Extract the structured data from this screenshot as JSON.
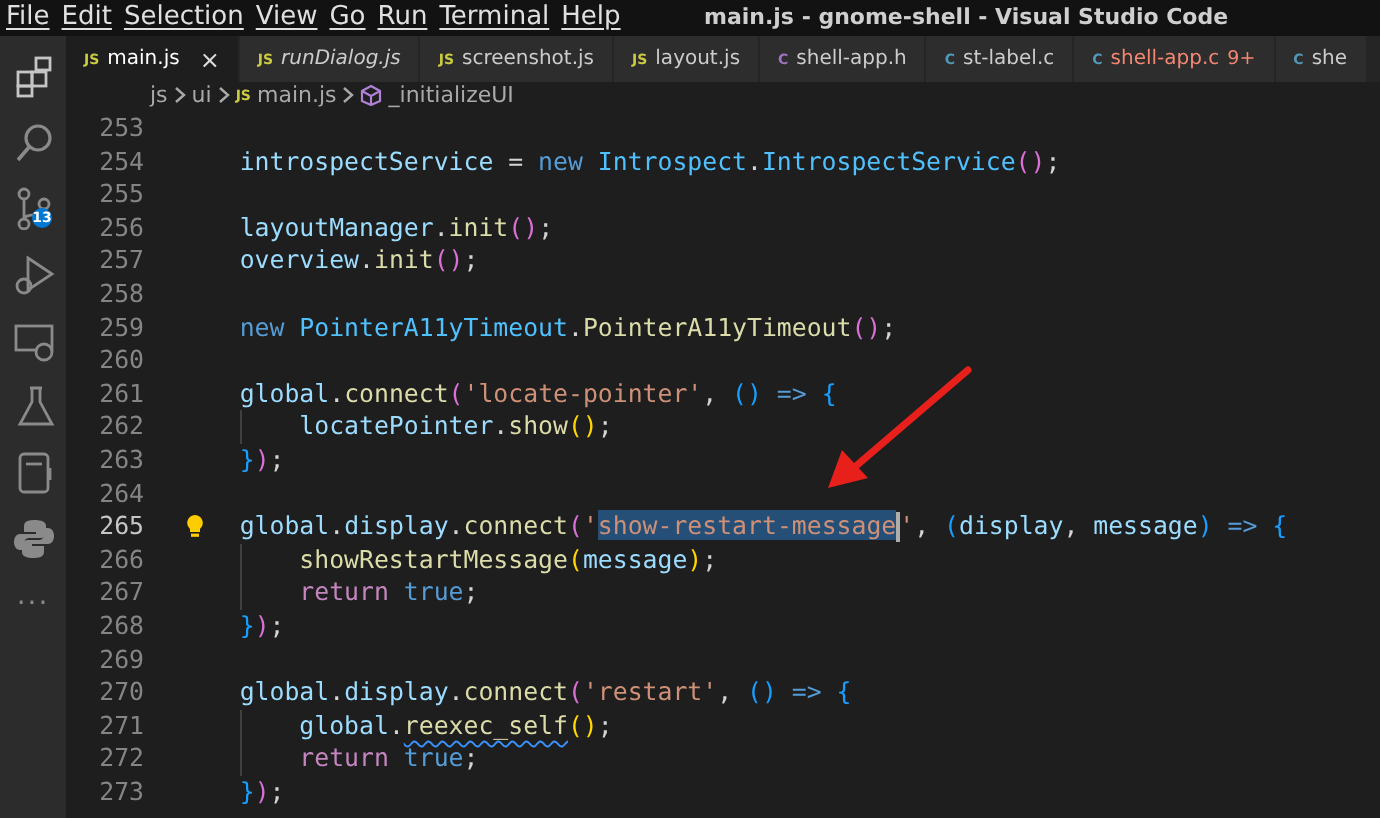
{
  "window": {
    "title": "main.js - gnome-shell - Visual Studio Code"
  },
  "menu": [
    "File",
    "Edit",
    "Selection",
    "View",
    "Go",
    "Run",
    "Terminal",
    "Help"
  ],
  "activity_bar": [
    {
      "kind": "explorer"
    },
    {
      "kind": "search"
    },
    {
      "kind": "source-control",
      "badge": "13"
    },
    {
      "kind": "run"
    },
    {
      "kind": "remote"
    },
    {
      "kind": "testing"
    },
    {
      "kind": "notebook"
    },
    {
      "kind": "python"
    },
    {
      "kind": "more",
      "text": "···"
    }
  ],
  "tabs": [
    {
      "icon": "JS",
      "kind": "js",
      "label": "main.js",
      "selected": true,
      "preview": false,
      "close": "×"
    },
    {
      "icon": "JS",
      "kind": "js",
      "label": "runDialog.js",
      "selected": false,
      "preview": true
    },
    {
      "icon": "JS",
      "kind": "js",
      "label": "screenshot.js",
      "selected": false,
      "preview": false
    },
    {
      "icon": "JS",
      "kind": "js",
      "label": "layout.js",
      "selected": false,
      "preview": false
    },
    {
      "icon": "C",
      "kind": "h",
      "label": "shell-app.h",
      "selected": false,
      "preview": false
    },
    {
      "icon": "C",
      "kind": "c",
      "label": "st-label.c",
      "selected": false,
      "preview": false
    },
    {
      "icon": "C",
      "kind": "c-error",
      "label": "shell-app.c",
      "selected": false,
      "preview": false,
      "problems": "9+"
    },
    {
      "icon": "C",
      "kind": "c",
      "label": "she",
      "selected": false,
      "preview": false
    }
  ],
  "breadcrumb": [
    {
      "kind": "folder",
      "label": "js"
    },
    {
      "kind": "folder",
      "label": "ui"
    },
    {
      "kind": "file",
      "icon": "JS",
      "label": "main.js"
    },
    {
      "kind": "method",
      "label": "_initializeUI"
    }
  ],
  "editor": {
    "lines": [
      {
        "number": "253",
        "current": false,
        "lightbulb": false
      },
      {
        "number": "254",
        "current": false,
        "lightbulb": false,
        "tokens": [
          {
            "text": "    introspectService",
            "kind": "var"
          },
          {
            "text": " = ",
            "kind": "plain"
          },
          {
            "text": "new",
            "kind": "kw"
          },
          {
            "text": " Introspect",
            "kind": "cls"
          },
          {
            "text": ".",
            "kind": "plain"
          },
          {
            "text": "IntrospectService",
            "kind": "cls"
          },
          {
            "text": "()",
            "kind": "b2"
          },
          {
            "text": ";",
            "kind": "plain"
          }
        ]
      },
      {
        "number": "255",
        "current": false,
        "lightbulb": false
      },
      {
        "number": "256",
        "current": false,
        "lightbulb": false,
        "tokens": [
          {
            "text": "    layoutManager",
            "kind": "var"
          },
          {
            "text": ".",
            "kind": "plain"
          },
          {
            "text": "init",
            "kind": "fn"
          },
          {
            "text": "()",
            "kind": "b2"
          },
          {
            "text": ";",
            "kind": "plain"
          }
        ]
      },
      {
        "number": "257",
        "current": false,
        "lightbulb": false,
        "tokens": [
          {
            "text": "    overview",
            "kind": "var"
          },
          {
            "text": ".",
            "kind": "plain"
          },
          {
            "text": "init",
            "kind": "fn"
          },
          {
            "text": "()",
            "kind": "b2"
          },
          {
            "text": ";",
            "kind": "plain"
          }
        ]
      },
      {
        "number": "258",
        "current": false,
        "lightbulb": false
      },
      {
        "number": "259",
        "current": false,
        "lightbulb": false,
        "tokens": [
          {
            "text": "    new",
            "kind": "kw"
          },
          {
            "text": " PointerA11yTimeout",
            "kind": "cls"
          },
          {
            "text": ".",
            "kind": "plain"
          },
          {
            "text": "PointerA11yTimeout",
            "kind": "fn"
          },
          {
            "text": "()",
            "kind": "b2"
          },
          {
            "text": ";",
            "kind": "plain"
          }
        ]
      },
      {
        "number": "260",
        "current": false,
        "lightbulb": false
      },
      {
        "number": "261",
        "current": false,
        "lightbulb": false,
        "tokens": [
          {
            "text": "    global",
            "kind": "var"
          },
          {
            "text": ".",
            "kind": "plain"
          },
          {
            "text": "connect",
            "kind": "fn"
          },
          {
            "text": "(",
            "kind": "b2"
          },
          {
            "text": "'locate-pointer'",
            "kind": "str"
          },
          {
            "text": ", ",
            "kind": "plain"
          },
          {
            "text": "()",
            "kind": "b3"
          },
          {
            "text": " => ",
            "kind": "kw"
          },
          {
            "text": "{",
            "kind": "b3"
          }
        ]
      },
      {
        "number": "262",
        "current": false,
        "lightbulb": false,
        "tokens": [
          {
            "text": "        locatePointer",
            "kind": "var"
          },
          {
            "text": ".",
            "kind": "plain"
          },
          {
            "text": "show",
            "kind": "fn"
          },
          {
            "text": "()",
            "kind": "b1"
          },
          {
            "text": ";",
            "kind": "plain"
          }
        ]
      },
      {
        "number": "263",
        "current": false,
        "lightbulb": false,
        "tokens": [
          {
            "text": "    }",
            "kind": "b3"
          },
          {
            "text": ")",
            "kind": "b2"
          },
          {
            "text": ";",
            "kind": "plain"
          }
        ]
      },
      {
        "number": "264",
        "current": false,
        "lightbulb": false
      },
      {
        "number": "265",
        "current": true,
        "lightbulb": true,
        "tokens": [
          {
            "text": "    global",
            "kind": "var"
          },
          {
            "text": ".",
            "kind": "plain"
          },
          {
            "text": "display",
            "kind": "var"
          },
          {
            "text": ".",
            "kind": "plain"
          },
          {
            "text": "connect",
            "kind": "fn"
          },
          {
            "text": "(",
            "kind": "b2"
          },
          {
            "text": "'",
            "kind": "str"
          },
          {
            "text": "show-restart-message",
            "kind": "sel"
          },
          {
            "text": "'",
            "kind": "str"
          },
          {
            "text": ", ",
            "kind": "plain"
          },
          {
            "text": "(",
            "kind": "b3"
          },
          {
            "text": "display",
            "kind": "var"
          },
          {
            "text": ", ",
            "kind": "plain"
          },
          {
            "text": "message",
            "kind": "var"
          },
          {
            "text": ")",
            "kind": "b3"
          },
          {
            "text": " => ",
            "kind": "kw"
          },
          {
            "text": "{",
            "kind": "b3"
          }
        ]
      },
      {
        "number": "266",
        "current": false,
        "lightbulb": false,
        "tokens": [
          {
            "text": "        showRestartMessage",
            "kind": "fn"
          },
          {
            "text": "(",
            "kind": "b1"
          },
          {
            "text": "message",
            "kind": "var"
          },
          {
            "text": ")",
            "kind": "b1"
          },
          {
            "text": ";",
            "kind": "plain"
          }
        ]
      },
      {
        "number": "267",
        "current": false,
        "lightbulb": false,
        "tokens": [
          {
            "text": "        return",
            "kind": "ctrl"
          },
          {
            "text": " true",
            "kind": "kw"
          },
          {
            "text": ";",
            "kind": "plain"
          }
        ]
      },
      {
        "number": "268",
        "current": false,
        "lightbulb": false,
        "tokens": [
          {
            "text": "    }",
            "kind": "b3"
          },
          {
            "text": ")",
            "kind": "b2"
          },
          {
            "text": ";",
            "kind": "plain"
          }
        ]
      },
      {
        "number": "269",
        "current": false,
        "lightbulb": false
      },
      {
        "number": "270",
        "current": false,
        "lightbulb": false,
        "tokens": [
          {
            "text": "    global",
            "kind": "var"
          },
          {
            "text": ".",
            "kind": "plain"
          },
          {
            "text": "display",
            "kind": "var"
          },
          {
            "text": ".",
            "kind": "plain"
          },
          {
            "text": "connect",
            "kind": "fn"
          },
          {
            "text": "(",
            "kind": "b2"
          },
          {
            "text": "'restart'",
            "kind": "str"
          },
          {
            "text": ", ",
            "kind": "plain"
          },
          {
            "text": "()",
            "kind": "b3"
          },
          {
            "text": " => ",
            "kind": "kw"
          },
          {
            "text": "{",
            "kind": "b3"
          }
        ]
      },
      {
        "number": "271",
        "current": false,
        "lightbulb": false,
        "tokens": [
          {
            "text": "        global",
            "kind": "var"
          },
          {
            "text": ".",
            "kind": "plain"
          },
          {
            "text": "reexec_self",
            "kind": "warn"
          },
          {
            "text": "()",
            "kind": "b1"
          },
          {
            "text": ";",
            "kind": "plain"
          }
        ]
      },
      {
        "number": "272",
        "current": false,
        "lightbulb": false,
        "tokens": [
          {
            "text": "        return",
            "kind": "ctrl"
          },
          {
            "text": " true",
            "kind": "kw"
          },
          {
            "text": ";",
            "kind": "plain"
          }
        ]
      },
      {
        "number": "273",
        "current": false,
        "lightbulb": false,
        "tokens": [
          {
            "text": "    }",
            "kind": "b3"
          },
          {
            "text": ")",
            "kind": "b2"
          },
          {
            "text": ";",
            "kind": "plain"
          }
        ]
      }
    ]
  },
  "annotation": {
    "kind": "arrow"
  }
}
